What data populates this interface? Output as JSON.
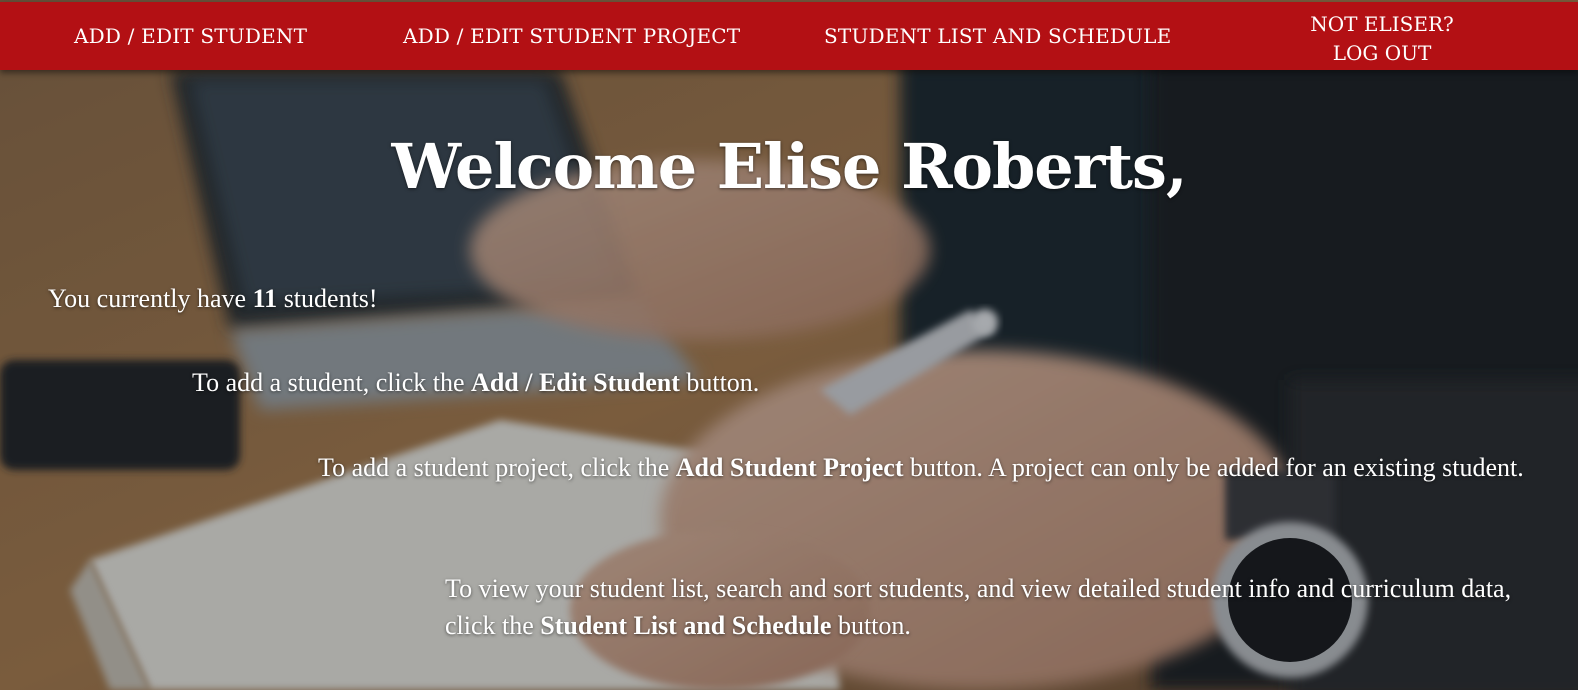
{
  "nav": {
    "add_student": "ADD / EDIT STUDENT",
    "add_project": "ADD / EDIT STUDENT PROJECT",
    "student_list": "STUDENT LIST AND SCHEDULE",
    "not_user": "NOT ELISER?",
    "logout": "LOG OUT"
  },
  "welcome": {
    "title": "Welcome Elise Roberts,"
  },
  "count": {
    "prefix": "You currently have ",
    "number": "11",
    "suffix": " students!"
  },
  "instructions": {
    "add_student": {
      "prefix": "To add a student, click the ",
      "button": "Add / Edit Student",
      "suffix": " button."
    },
    "add_project": {
      "prefix": "To add a student project, click the ",
      "button": "Add Student Project",
      "suffix": " button. A project can only be added for an existing student."
    },
    "student_list": {
      "prefix": "To view your student list, search and sort students, and view detailed student info and curriculum data, click the ",
      "button": "Student List and Schedule",
      "suffix": " button."
    }
  },
  "colors": {
    "navbar": "#b31014",
    "text": "#ffffff"
  },
  "background": {
    "description_icon": "desk-photo-background"
  }
}
